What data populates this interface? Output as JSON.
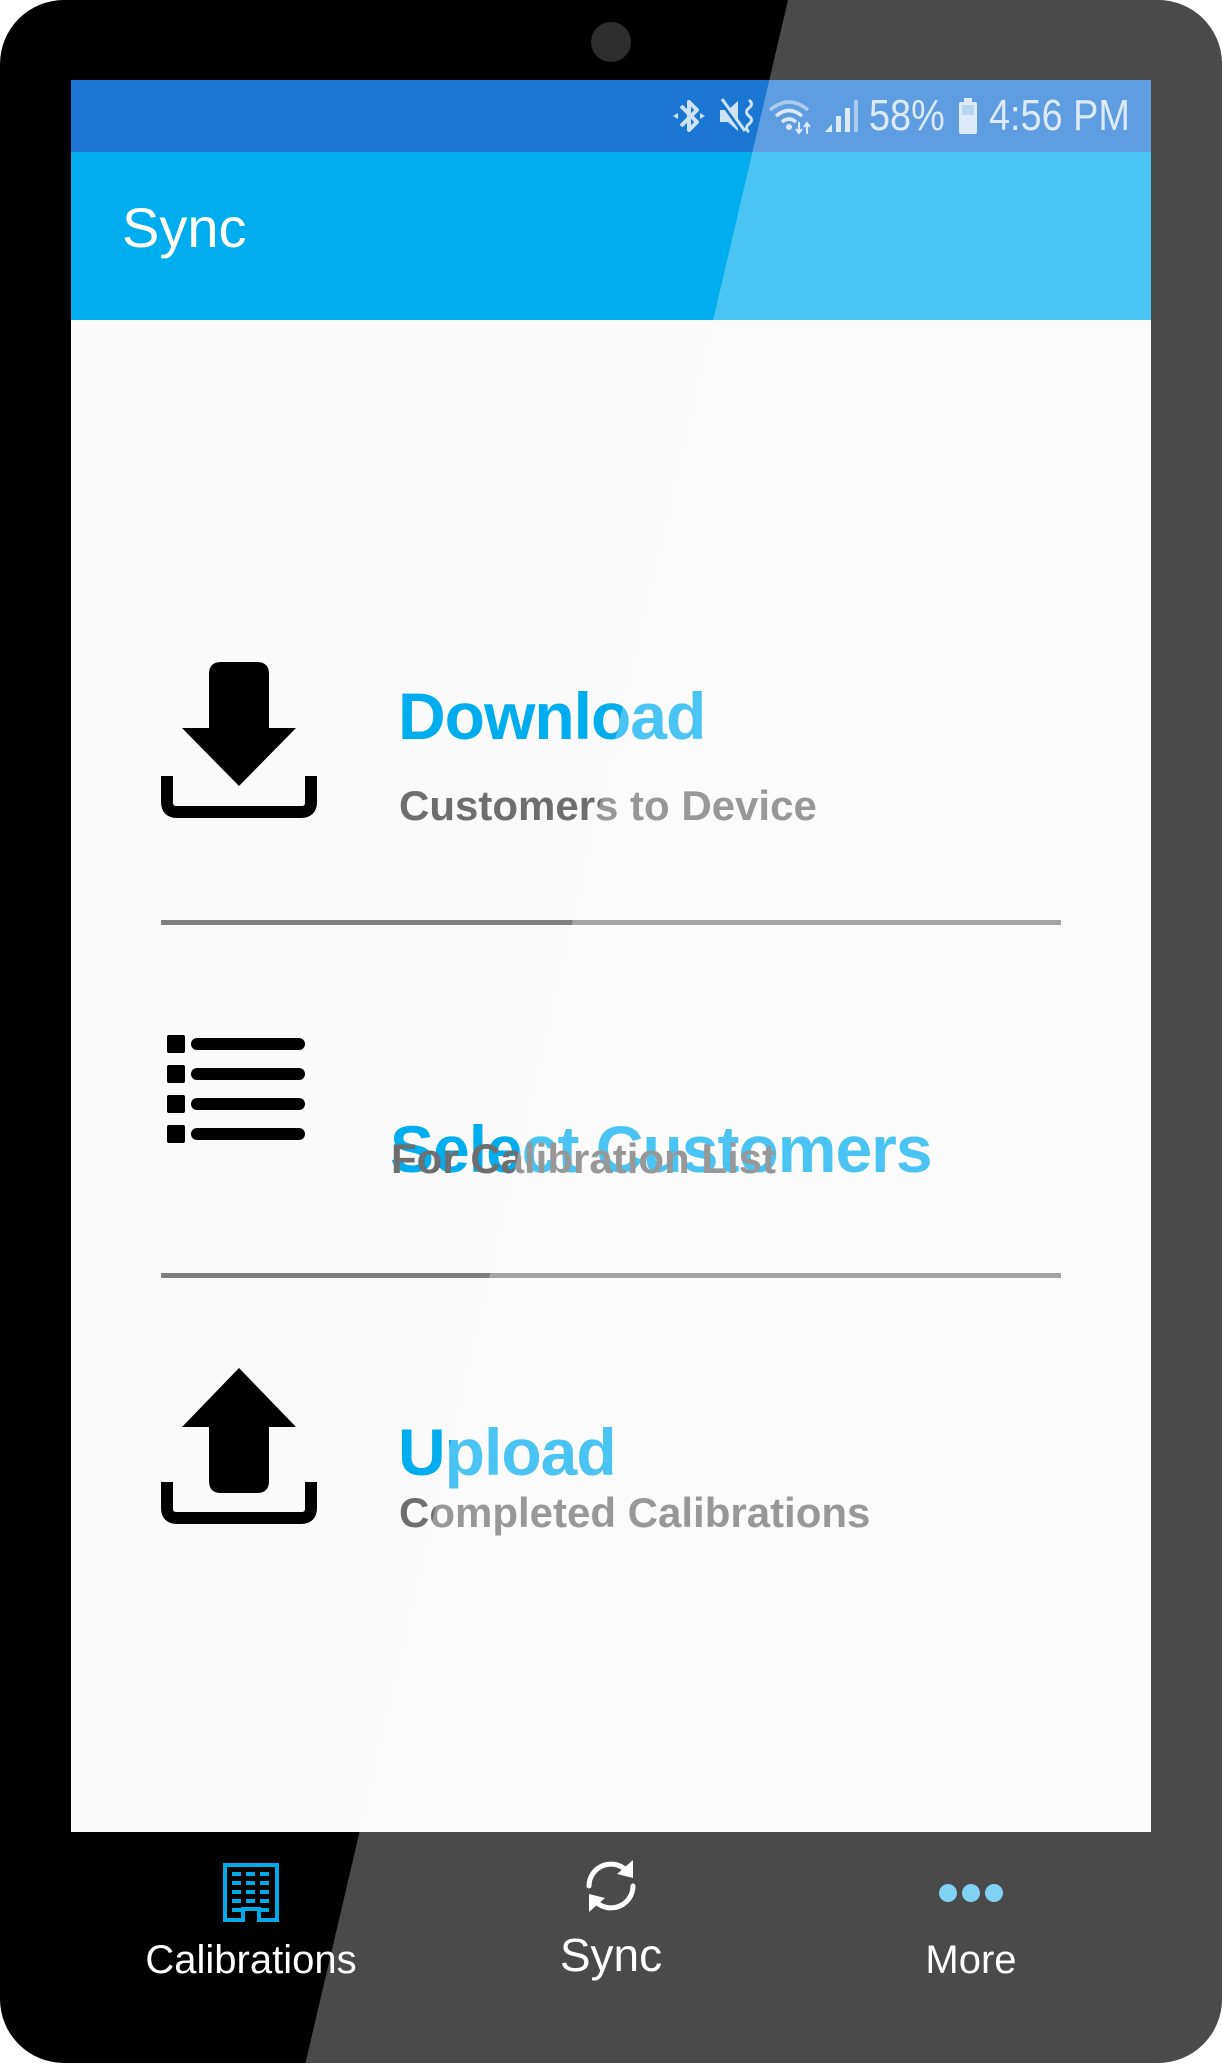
{
  "status_bar": {
    "icons": [
      "bluetooth-icon",
      "mute-vibrate-icon",
      "wifi-icon",
      "signal-icon",
      "battery-icon"
    ],
    "battery": "58%",
    "time": "4:56 PM"
  },
  "app_bar": {
    "title": "Sync"
  },
  "actions": [
    {
      "icon": "download-icon",
      "title": "Download",
      "subtitle": "Customers to Device"
    },
    {
      "icon": "list-icon",
      "title": "Select Customers",
      "subtitle": "For Calibration List"
    },
    {
      "icon": "upload-icon",
      "title": "Upload",
      "subtitle": "Completed Calibrations"
    }
  ],
  "bottom_nav": {
    "tabs": [
      {
        "icon": "building-icon",
        "label": "Calibrations",
        "active": true
      },
      {
        "icon": "sync-icon",
        "label": "Sync",
        "active": false
      },
      {
        "icon": "more-dots-icon",
        "label": "More",
        "active": false
      }
    ]
  },
  "colors": {
    "status_bar": "#1b76d3",
    "app_bar": "#00adee",
    "accent": "#00adee",
    "active_tab_icon": "#00a9e8",
    "subtitle": "#6e6e6e",
    "divider": "#7f7f7f",
    "bezel": "#000000"
  }
}
